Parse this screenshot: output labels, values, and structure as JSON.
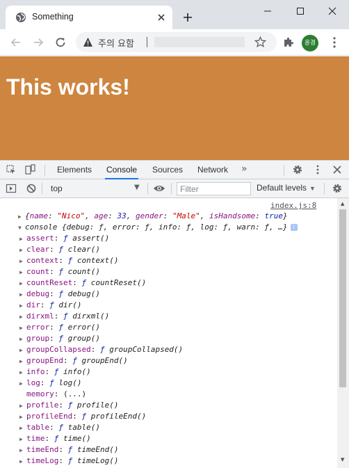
{
  "browser": {
    "tab_title": "Something",
    "security_label": "주의 요함",
    "avatar_text": "윤경"
  },
  "page": {
    "heading": "This works!",
    "background_color": "#cd853f"
  },
  "devtools": {
    "tabs": [
      "Elements",
      "Console",
      "Sources",
      "Network"
    ],
    "active_tab": "Console",
    "more_tabs": "»",
    "context": "top",
    "filter_placeholder": "Filter",
    "levels_label": "Default levels"
  },
  "console": {
    "source_link": "index.js:8",
    "object_line": {
      "name_value": "\"Nico\"",
      "age_value": "33",
      "gender_value": "\"Male\"",
      "isHandsome_value": "true"
    },
    "console_line": "console {debug: ƒ, error: ƒ, info: ƒ, log: ƒ, warn: ƒ, …}",
    "properties": [
      {
        "key": "assert",
        "value": "assert()"
      },
      {
        "key": "clear",
        "value": "clear()"
      },
      {
        "key": "context",
        "value": "context()"
      },
      {
        "key": "count",
        "value": "count()"
      },
      {
        "key": "countReset",
        "value": "countReset()"
      },
      {
        "key": "debug",
        "value": "debug()"
      },
      {
        "key": "dir",
        "value": "dir()"
      },
      {
        "key": "dirxml",
        "value": "dirxml()"
      },
      {
        "key": "error",
        "value": "error()"
      },
      {
        "key": "group",
        "value": "group()"
      },
      {
        "key": "groupCollapsed",
        "value": "groupCollapsed()"
      },
      {
        "key": "groupEnd",
        "value": "groupEnd()"
      },
      {
        "key": "info",
        "value": "info()"
      },
      {
        "key": "log",
        "value": "log()"
      },
      {
        "key": "memory",
        "value": "(...)"
      },
      {
        "key": "profile",
        "value": "profile()"
      },
      {
        "key": "profileEnd",
        "value": "profileEnd()"
      },
      {
        "key": "table",
        "value": "table()"
      },
      {
        "key": "time",
        "value": "time()"
      },
      {
        "key": "timeEnd",
        "value": "timeEnd()"
      },
      {
        "key": "timeLog",
        "value": "timeLog()"
      }
    ]
  }
}
